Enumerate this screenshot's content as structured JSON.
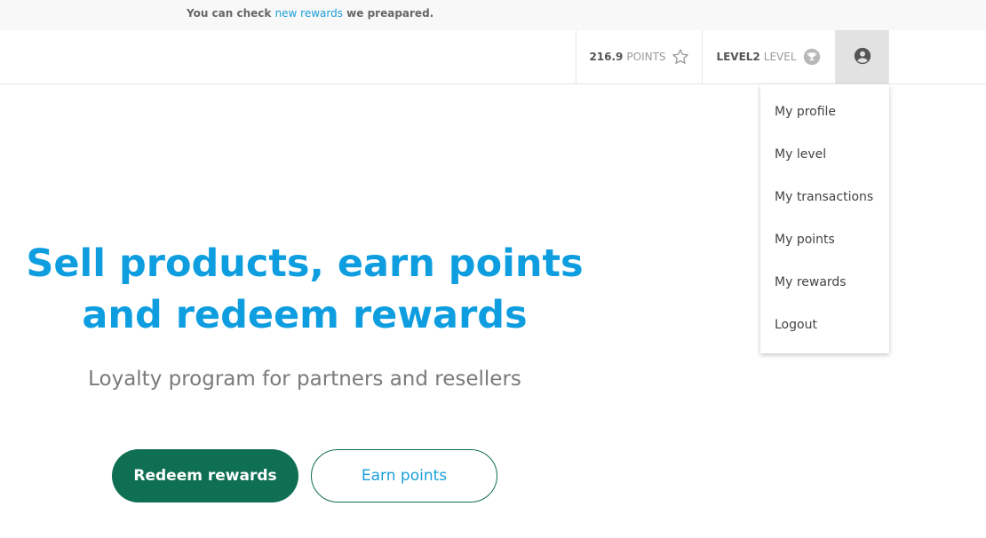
{
  "notice": {
    "prefix": "You can check ",
    "link": "new rewards",
    "suffix": " we preapared."
  },
  "nav": {
    "points_value": "216.9",
    "points_unit": "POINTS",
    "points_icon": "star-icon",
    "level_value": "LEVEL2",
    "level_unit": "LEVEL",
    "level_icon": "trophy-icon",
    "user_icon": "user-circle-icon"
  },
  "menu": {
    "items": [
      "My profile",
      "My level",
      "My transactions",
      "My points",
      "My rewards",
      "Logout"
    ]
  },
  "hero": {
    "title_line1": "Sell products, earn points",
    "title_line2": "and redeem rewards",
    "subtitle": "Loyalty program for partners and resellers",
    "primary_button": "Redeem rewards",
    "secondary_button": "Earn points"
  },
  "colors": {
    "accent": "#0e9ee0",
    "primary_button": "#0f6f52",
    "link": "#1a9fd9"
  }
}
